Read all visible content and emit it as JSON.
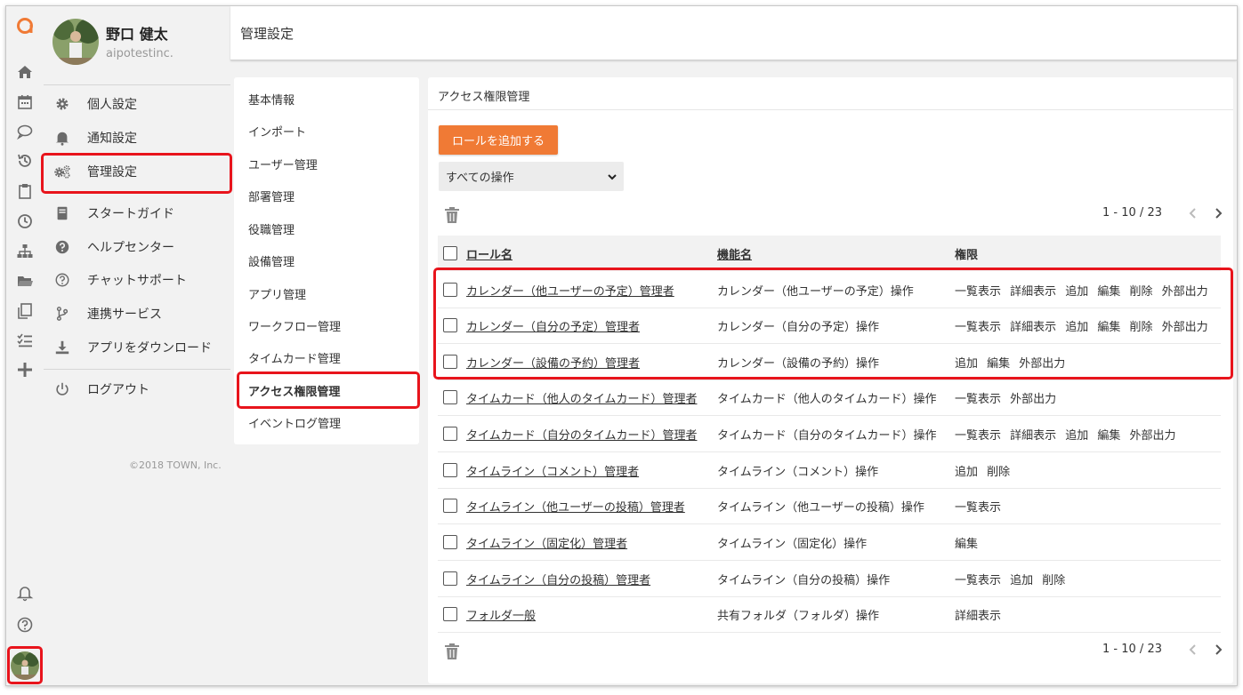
{
  "user": {
    "name": "野口 健太",
    "company": "aipotestinc."
  },
  "side_menu": {
    "items": [
      {
        "label": "個人設定",
        "icon": "gear-icon"
      },
      {
        "label": "通知設定",
        "icon": "bell-icon"
      },
      {
        "label": "管理設定",
        "icon": "gears-icon"
      },
      {
        "label": "スタートガイド",
        "icon": "book-icon"
      },
      {
        "label": "ヘルプセンター",
        "icon": "question-circle-icon"
      },
      {
        "label": "チャットサポート",
        "icon": "question-outline-icon"
      },
      {
        "label": "連携サービス",
        "icon": "branch-icon"
      },
      {
        "label": "アプリをダウンロード",
        "icon": "download-icon"
      }
    ],
    "logout": "ログアウト",
    "copyright": "©2018 TOWN, Inc."
  },
  "header": {
    "title": "管理設定"
  },
  "sub_nav": {
    "items": [
      "基本情報",
      "インポート",
      "ユーザー管理",
      "部署管理",
      "役職管理",
      "設備管理",
      "アプリ管理",
      "ワークフロー管理",
      "タイムカード管理",
      "アクセス権限管理",
      "イベントログ管理"
    ],
    "active": "アクセス権限管理"
  },
  "panel": {
    "title": "アクセス権限管理",
    "add_role_label": "ロールを追加する",
    "filter_value": "すべての操作",
    "pagination": "1 - 10 / 23",
    "columns": [
      "ロール名",
      "機能名",
      "権限"
    ],
    "rows": [
      {
        "role": "カレンダー（他ユーザーの予定）管理者",
        "feature": "カレンダー（他ユーザーの予定）操作",
        "perms": "一覧表示 詳細表示 追加 編集 削除 外部出力"
      },
      {
        "role": "カレンダー（自分の予定）管理者",
        "feature": "カレンダー（自分の予定）操作",
        "perms": "一覧表示 詳細表示 追加 編集 削除 外部出力"
      },
      {
        "role": "カレンダー（設備の予約）管理者",
        "feature": "カレンダー（設備の予約）操作",
        "perms": "追加 編集 外部出力"
      },
      {
        "role": "タイムカード（他人のタイムカード）管理者",
        "feature": "タイムカード（他人のタイムカード）操作",
        "perms": "一覧表示 外部出力"
      },
      {
        "role": "タイムカード（自分のタイムカード）管理者",
        "feature": "タイムカード（自分のタイムカード）操作",
        "perms": "一覧表示 詳細表示 追加 編集 外部出力"
      },
      {
        "role": "タイムライン（コメント）管理者",
        "feature": "タイムライン（コメント）操作",
        "perms": "追加 削除"
      },
      {
        "role": "タイムライン（他ユーザーの投稿）管理者",
        "feature": "タイムライン（他ユーザーの投稿）操作",
        "perms": "一覧表示"
      },
      {
        "role": "タイムライン（固定化）管理者",
        "feature": "タイムライン（固定化）操作",
        "perms": "編集"
      },
      {
        "role": "タイムライン（自分の投稿）管理者",
        "feature": "タイムライン（自分の投稿）操作",
        "perms": "一覧表示 追加 削除"
      },
      {
        "role": "フォルダ一般",
        "feature": "共有フォルダ（フォルダ）操作",
        "perms": "詳細表示"
      }
    ]
  },
  "colors": {
    "accent": "#f07a35",
    "highlight": "#e8141c",
    "icon": "#6b6b6b",
    "brand": "#f07a35"
  }
}
